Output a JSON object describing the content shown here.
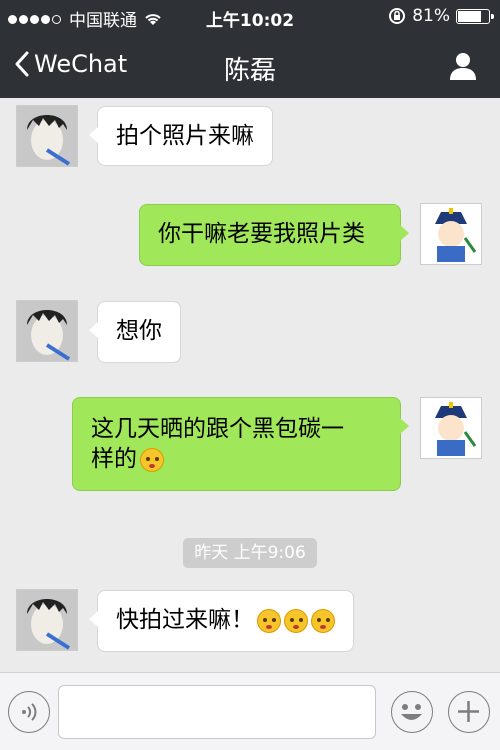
{
  "status_bar": {
    "carrier": "中国联通",
    "time": "上午10:02",
    "battery": "81%",
    "battery_level": 0.81
  },
  "nav": {
    "back_label": "WeChat",
    "title": "陈磊"
  },
  "messages": [
    {
      "side": "incoming",
      "text": "拍个照片来嘛"
    },
    {
      "side": "outgoing",
      "text": "你干嘛老要我照片类"
    },
    {
      "side": "incoming",
      "text": "想你"
    },
    {
      "side": "outgoing",
      "line1": "这几天晒的跟个黑包碳一",
      "line2": "样的",
      "emoji": "blushing-emoji"
    },
    {
      "side": "incoming",
      "text": "快拍过来嘛！",
      "emojis": [
        "kissing-emoji",
        "kissing-emoji",
        "kissing-emoji"
      ]
    }
  ],
  "timestamp": "昨天 上午9:06",
  "input": {
    "placeholder": ""
  },
  "colors": {
    "bar": "#2e3135",
    "chat_bg": "#ebebeb",
    "outgoing_bubble": "#a0e75a",
    "incoming_bubble": "#ffffff"
  }
}
